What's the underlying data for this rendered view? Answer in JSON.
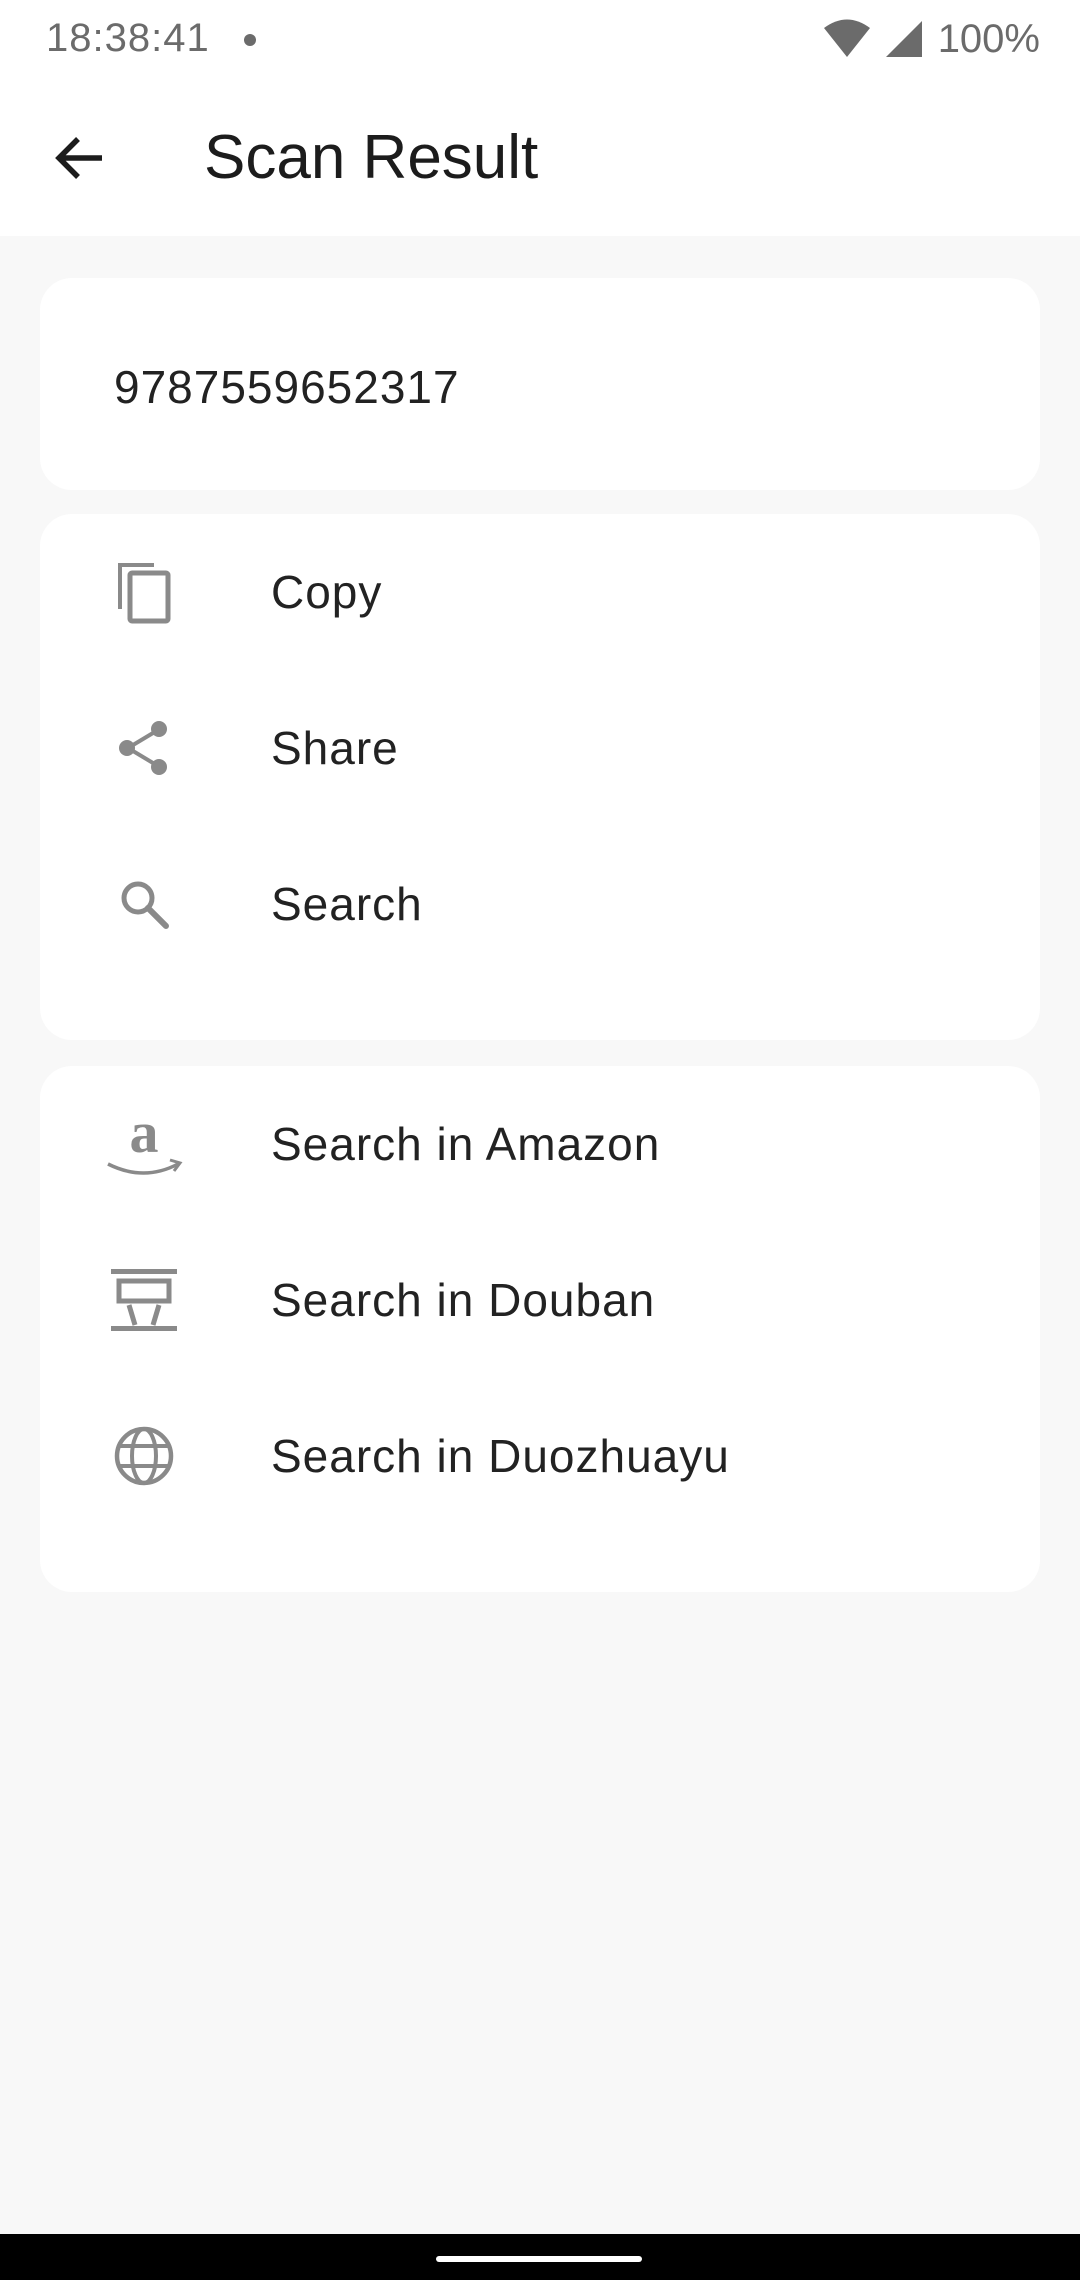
{
  "status": {
    "time": "18:38:41",
    "battery": "100%"
  },
  "app_bar": {
    "title": "Scan Result",
    "back_icon": "arrow-back-icon"
  },
  "result": {
    "value": "9787559652317"
  },
  "actions": [
    {
      "label": "Copy",
      "icon": "copy-icon"
    },
    {
      "label": "Share",
      "icon": "share-icon"
    },
    {
      "label": "Search",
      "icon": "search-icon"
    }
  ],
  "search_engines": [
    {
      "label": "Search in Amazon",
      "icon": "amazon-icon"
    },
    {
      "label": "Search in Douban",
      "icon": "douban-icon"
    },
    {
      "label": "Search in Duozhuayu",
      "icon": "globe-icon"
    }
  ],
  "colors": {
    "background": "#f8f8f8",
    "card": "#ffffff",
    "icon_gray": "#8a8a8a",
    "text": "#222222"
  }
}
